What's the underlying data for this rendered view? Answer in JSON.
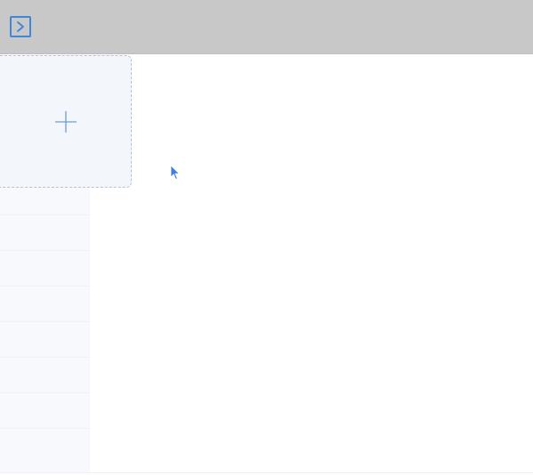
{
  "toolbar": {
    "expand_icon": "chevron-right-in-square-icon"
  },
  "main": {
    "add_tile_icon": "plus-icon"
  },
  "pointer": {
    "icon": "mouse-pointer-icon"
  },
  "colors": {
    "topbar": "#c8c8c8",
    "accent": "#3f86d6",
    "tile_background": "#f3f6fb",
    "tile_border": "#b9c1cc",
    "pointer": "#3f7fe0"
  }
}
